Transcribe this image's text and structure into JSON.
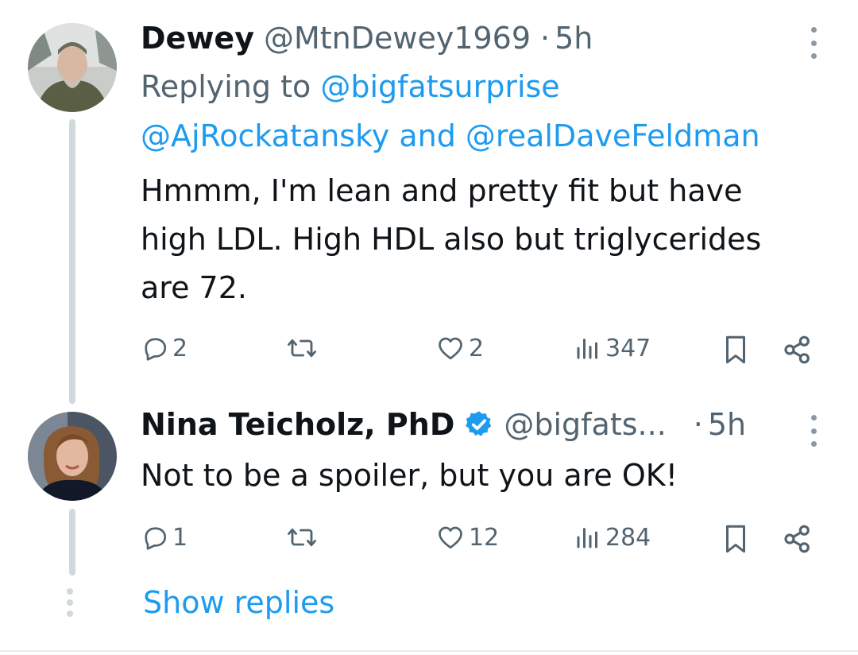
{
  "colors": {
    "link": "#1d9bf0",
    "muted": "#536471",
    "verified": "#1d9bf0",
    "thread_line": "#cfd9de"
  },
  "tweet1": {
    "name": "Dewey",
    "handle": "@MtnDewey1969",
    "sep": "·",
    "time": "5h",
    "replying_prefix": "Replying to",
    "mention1": "@bigfatsurprise",
    "mention2": "@AjRockatansky",
    "and_word": "and",
    "mention3": "@realDaveFeldman",
    "text_line1": "Hmmm, I'm lean and pretty fit but have",
    "text_line2": "high LDL.  High HDL also but triglycerides",
    "text_line3": "are 72.",
    "replies": "2",
    "likes": "2",
    "views": "347",
    "icons": [
      "reply-icon",
      "retweet-icon",
      "like-icon",
      "views-icon",
      "bookmark-icon",
      "share-icon",
      "more-icon"
    ]
  },
  "tweet2": {
    "name": "Nina Teicholz, PhD",
    "handle": "@bigfats...",
    "sep": "·",
    "time": "5h",
    "verified": true,
    "text": "Not to be a spoiler, but you are OK!",
    "replies": "1",
    "likes": "12",
    "views": "284"
  },
  "show_replies": "Show replies"
}
